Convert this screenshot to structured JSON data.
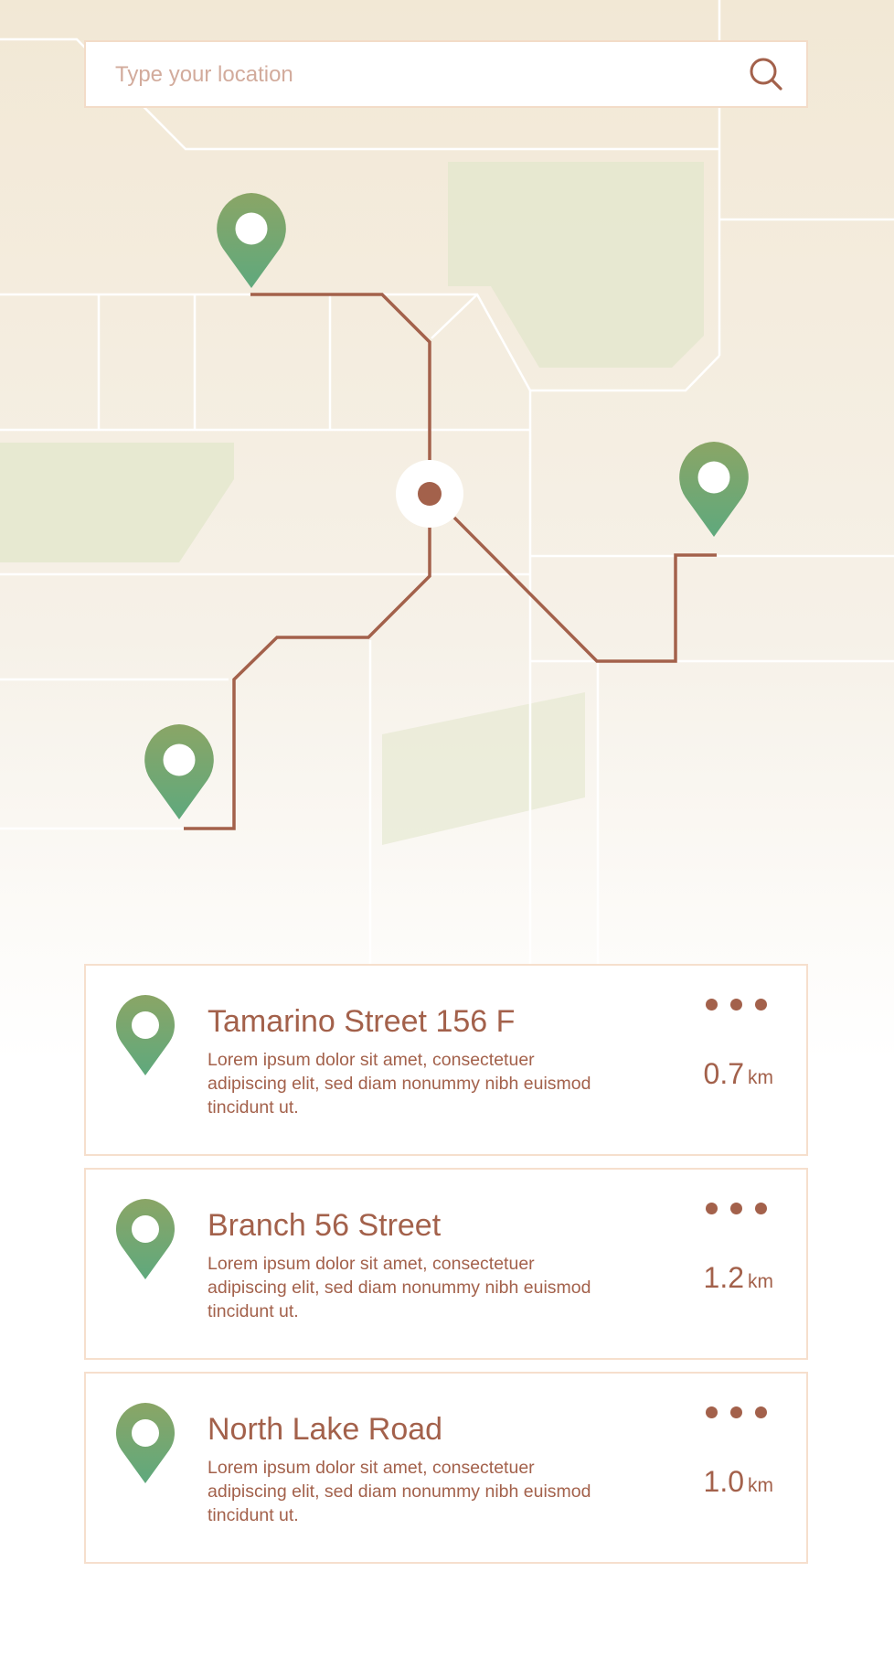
{
  "search": {
    "placeholder": "Type your location",
    "icon": "search-icon"
  },
  "map": {
    "pins": [
      {
        "name": "map-pin-north",
        "color": "#6fa877"
      },
      {
        "name": "map-pin-east",
        "color": "#6fa877"
      },
      {
        "name": "map-pin-southwest",
        "color": "#6fa877"
      }
    ],
    "current_location": {
      "color": "#a3614b"
    },
    "route_color": "#a3614b"
  },
  "results": [
    {
      "title": "Tamarino Street 156 F",
      "description": "Lorem ipsum dolor sit amet, consectetuer adipiscing elit, sed diam nonummy nibh euismod tincidunt ut.",
      "distance": "0.7",
      "unit": "km",
      "menu_icon": "more-icon"
    },
    {
      "title": "Branch 56 Street",
      "description": "Lorem ipsum dolor sit amet, consectetuer adipiscing elit, sed diam nonummy nibh euismod tincidunt ut.",
      "distance": "1.2",
      "unit": "km",
      "menu_icon": "more-icon"
    },
    {
      "title": "North Lake Road",
      "description": "Lorem ipsum dolor sit amet, consectetuer adipiscing elit, sed diam nonummy nibh euismod tincidunt ut.",
      "distance": "1.0",
      "unit": "km",
      "menu_icon": "more-icon"
    }
  ],
  "colors": {
    "accent": "#a3614b",
    "pin_green": "#6fa877",
    "pin_green_top": "#8aa566",
    "park": "#e6e8d0",
    "road": "#ffffff",
    "border": "#f6dfcd"
  }
}
